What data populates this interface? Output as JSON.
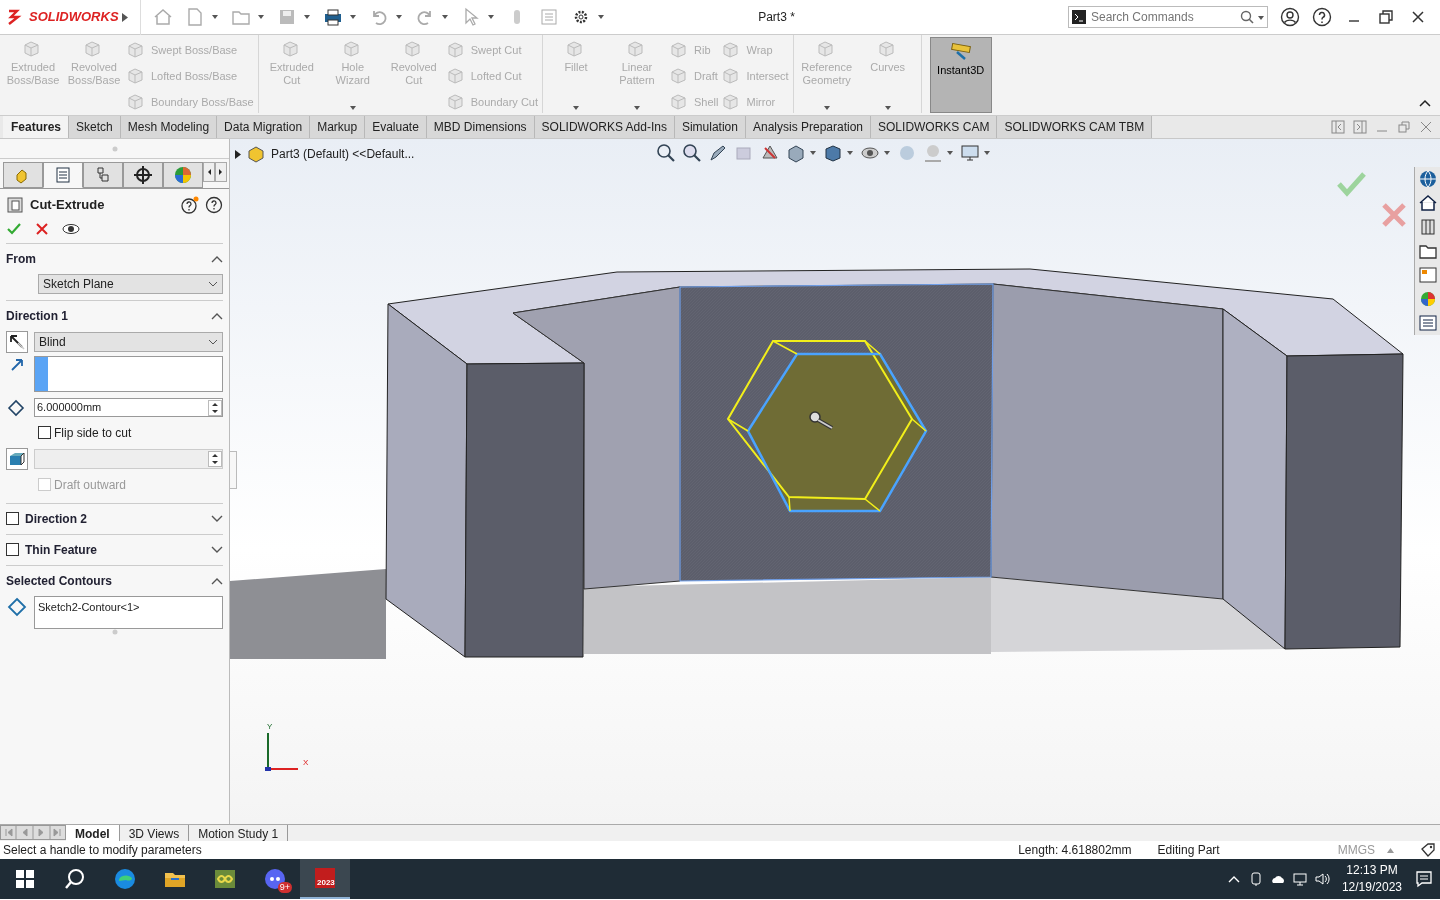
{
  "titlebar": {
    "logo": "SOLIDWORKS",
    "title": "Part3 *",
    "search_placeholder": "Search Commands"
  },
  "ribbon": {
    "groups": [
      {
        "items": [
          {
            "kind": "large",
            "label": "Extruded Boss/Base",
            "disabled": true,
            "menu": false
          },
          {
            "kind": "large",
            "label": "Revolved Boss/Base",
            "disabled": true,
            "menu": false
          },
          {
            "kind": "column",
            "items": [
              {
                "label": "Swept Boss/Base",
                "disabled": true
              },
              {
                "label": "Lofted Boss/Base",
                "disabled": true
              },
              {
                "label": "Boundary Boss/Base",
                "disabled": true
              }
            ]
          }
        ]
      },
      {
        "items": [
          {
            "kind": "large",
            "label": "Extruded Cut",
            "disabled": true,
            "menu": false
          },
          {
            "kind": "large",
            "label": "Hole Wizard",
            "disabled": true,
            "menu": true
          },
          {
            "kind": "large",
            "label": "Revolved Cut",
            "disabled": true,
            "menu": false
          },
          {
            "kind": "column",
            "items": [
              {
                "label": "Swept Cut",
                "disabled": true
              },
              {
                "label": "Lofted Cut",
                "disabled": true
              },
              {
                "label": "Boundary Cut",
                "disabled": true
              }
            ]
          }
        ]
      },
      {
        "items": [
          {
            "kind": "large",
            "label": "Fillet",
            "disabled": true,
            "menu": true
          },
          {
            "kind": "large",
            "label": "Linear Pattern",
            "disabled": true,
            "menu": true
          },
          {
            "kind": "column",
            "items": [
              {
                "label": "Rib",
                "disabled": true
              },
              {
                "label": "Draft",
                "disabled": true
              },
              {
                "label": "Shell",
                "disabled": true
              }
            ]
          },
          {
            "kind": "column",
            "items": [
              {
                "label": "Wrap",
                "disabled": true
              },
              {
                "label": "Intersect",
                "disabled": true
              },
              {
                "label": "Mirror",
                "disabled": true
              }
            ]
          }
        ]
      },
      {
        "items": [
          {
            "kind": "large",
            "label": "Reference Geometry",
            "disabled": true,
            "menu": true
          },
          {
            "kind": "large",
            "label": "Curves",
            "disabled": true,
            "menu": true
          }
        ]
      },
      {
        "items": [
          {
            "kind": "toggle",
            "label": "Instant3D",
            "on": true
          }
        ]
      }
    ]
  },
  "command_tabs": [
    {
      "label": "Features",
      "selected": true
    },
    {
      "label": "Sketch",
      "selected": false
    },
    {
      "label": "Mesh Modeling",
      "selected": false
    },
    {
      "label": "Data Migration",
      "selected": false
    },
    {
      "label": "Markup",
      "selected": false
    },
    {
      "label": "Evaluate",
      "selected": false
    },
    {
      "label": "MBD Dimensions",
      "selected": false
    },
    {
      "label": "SOLIDWORKS Add-Ins",
      "selected": false
    },
    {
      "label": "Simulation",
      "selected": false
    },
    {
      "label": "Analysis Preparation",
      "selected": false
    },
    {
      "label": "SOLIDWORKS CAM",
      "selected": false
    },
    {
      "label": "SOLIDWORKS CAM TBM",
      "selected": false
    }
  ],
  "panel_tabs": [
    {
      "kind": "features",
      "selected": false
    },
    {
      "kind": "properties",
      "selected": true
    },
    {
      "kind": "config",
      "selected": false
    },
    {
      "kind": "dimxpert",
      "selected": false
    },
    {
      "kind": "display",
      "selected": false
    }
  ],
  "property_manager": {
    "title": "Cut-Extrude",
    "from": {
      "label": "From",
      "expanded": true,
      "value": "Sketch Plane"
    },
    "direction1": {
      "label": "Direction 1",
      "expanded": true,
      "end_condition": "Blind",
      "depth": "6.000000mm",
      "flip_side": {
        "label": "Flip side to cut",
        "checked": false
      },
      "draft_outward": {
        "label": "Draft outward",
        "checked": false,
        "disabled": true
      }
    },
    "direction2": {
      "label": "Direction 2",
      "checked": false,
      "expanded": false
    },
    "thin_feature": {
      "label": "Thin Feature",
      "checked": false,
      "expanded": false
    },
    "selected_contours": {
      "label": "Selected Contours",
      "expanded": true,
      "items": [
        "Sketch2-Contour<1>"
      ]
    }
  },
  "breadcrumb": "Part3 (Default) <<Default...",
  "triad": {
    "y": "Y",
    "x": "X"
  },
  "bottom_tabs": [
    {
      "label": "Model",
      "selected": true
    },
    {
      "label": "3D Views",
      "selected": false
    },
    {
      "label": "Motion Study 1",
      "selected": false
    }
  ],
  "status_bar": {
    "message": "Select a handle to modify parameters",
    "length": "Length: 4.618802mm",
    "mode": "Editing Part",
    "units": "MMGS"
  },
  "taskbar": {
    "apps": [
      {
        "kind": "edge",
        "active": false
      },
      {
        "kind": "folder",
        "active": false
      },
      {
        "kind": "game",
        "active": false
      },
      {
        "kind": "chat",
        "active": false,
        "badge": "9+"
      },
      {
        "kind": "solidworks",
        "active": true,
        "label": "2023"
      }
    ],
    "time": "12:13 PM",
    "date": "12/19/2023"
  }
}
